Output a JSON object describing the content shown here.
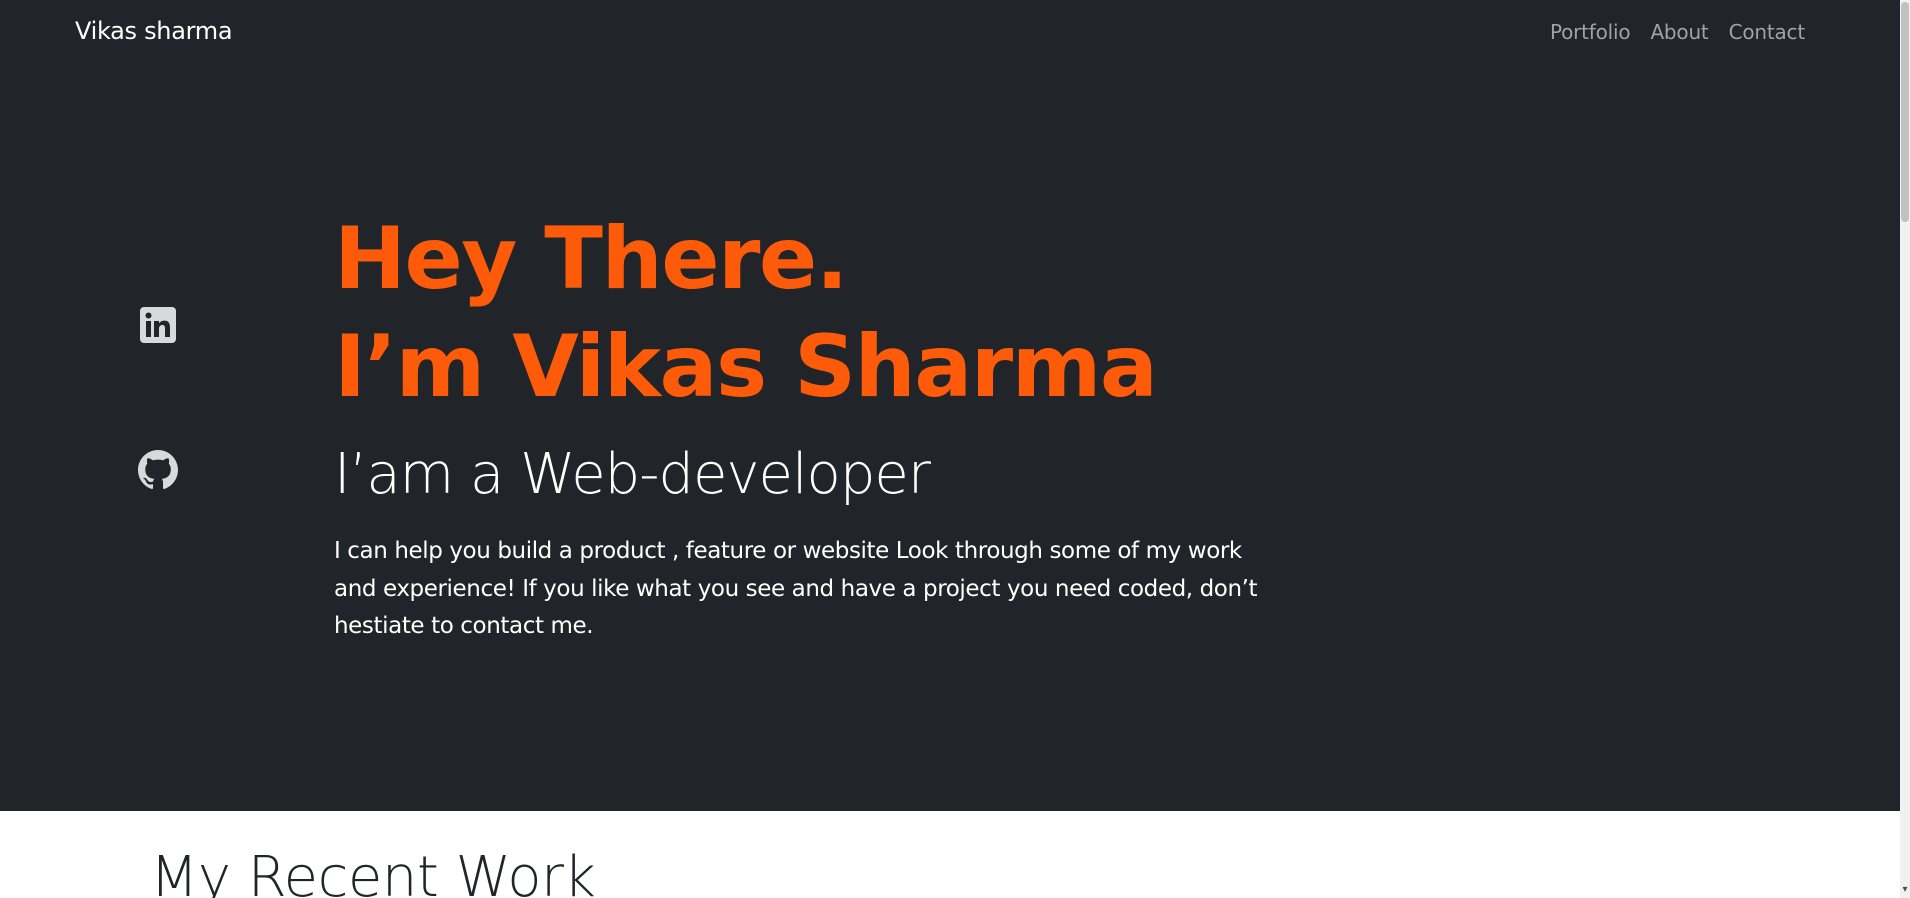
{
  "header": {
    "brand": "Vikas sharma",
    "nav": [
      "Portfolio",
      "About",
      "Contact"
    ]
  },
  "social": [
    {
      "icon": "linkedin-icon"
    },
    {
      "icon": "github-icon"
    }
  ],
  "hero": {
    "headline_line1": "Hey There.",
    "headline_line2": "I’m Vikas Sharma",
    "subheadline": "I’am a Web-developer",
    "intro": "I can help you build a product , feature or website Look through some of my work and experience! If you like what you see and have a project you need coded, don’t hestiate to contact me."
  },
  "next_section": {
    "title": "My Recent Work"
  },
  "colors": {
    "hero_background": "#212429",
    "accent": "#fd5b09",
    "nav_text": "#9ea3a8",
    "icon": "#d8d9da"
  }
}
